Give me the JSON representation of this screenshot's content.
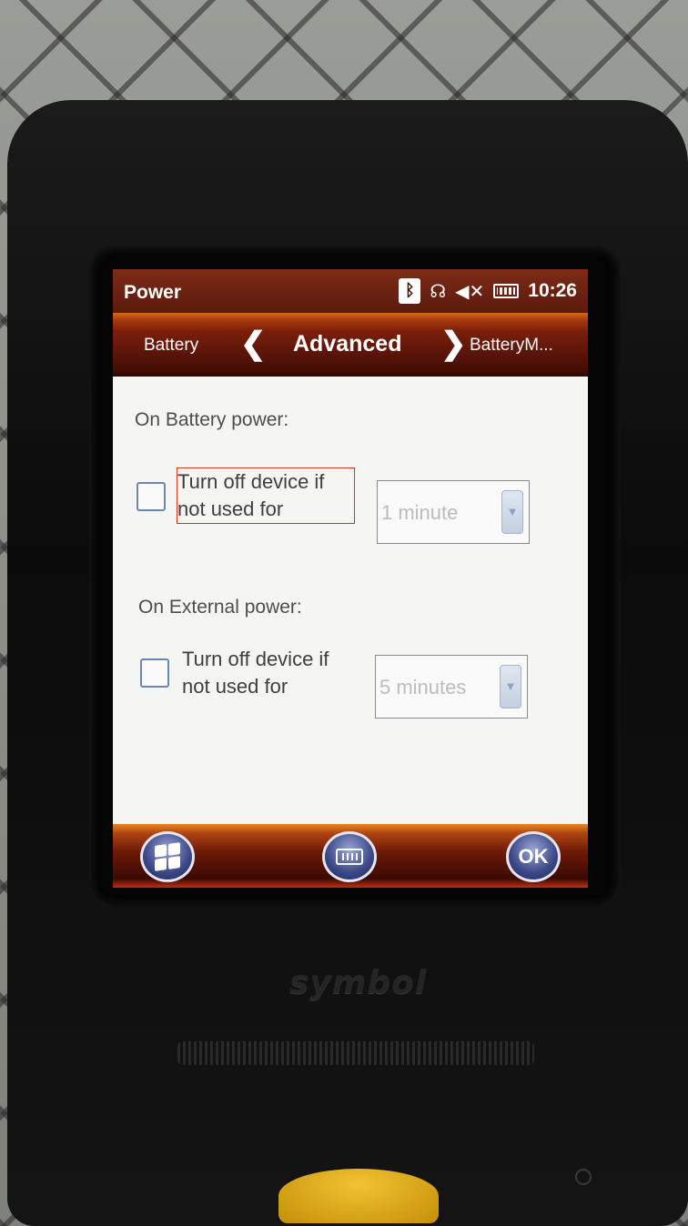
{
  "status_bar": {
    "title": "Power",
    "icons": [
      "bluetooth-icon",
      "connectivity-icon",
      "volume-muted-icon",
      "battery-icon"
    ],
    "clock": "10:26"
  },
  "tabs": {
    "previous": "Battery",
    "current": "Advanced",
    "next": "BatteryM..."
  },
  "battery_section": {
    "label": "On Battery power:",
    "checkbox_label": "Turn off device if not used for",
    "checked": false,
    "timeout": "1 minute"
  },
  "external_section": {
    "label": "On External power:",
    "checkbox_label": "Turn off device if not used for",
    "checked": false,
    "timeout": "5 minutes"
  },
  "soft_keys": {
    "start_icon": "windows-start-icon",
    "keyboard_icon": "keyboard-icon",
    "ok_label": "OK"
  },
  "device": {
    "brand": "symbol"
  },
  "colors": {
    "title_bar": "#6b2010",
    "accent": "#d46b16",
    "focus_border": "#d8311d",
    "orb": "#3b4787"
  }
}
